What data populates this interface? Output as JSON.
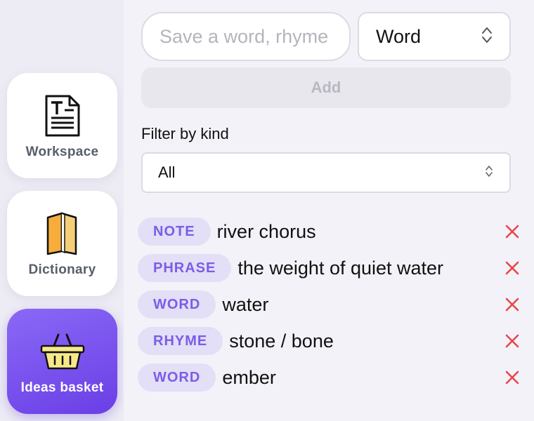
{
  "sidebar": {
    "items": [
      {
        "label": "Workspace",
        "icon": "document-icon",
        "active": false
      },
      {
        "label": "Dictionary",
        "icon": "book-icon",
        "active": false
      },
      {
        "label": "Ideas basket",
        "icon": "basket-icon",
        "active": true
      }
    ]
  },
  "composer": {
    "input_placeholder": "Save a word, rhyme",
    "input_value": "",
    "kind_value": "Word",
    "add_label": "Add"
  },
  "filter": {
    "label": "Filter by kind",
    "value": "All"
  },
  "ideas": [
    {
      "kind": "NOTE",
      "text": "river chorus"
    },
    {
      "kind": "PHRASE",
      "text": "the weight of quiet water"
    },
    {
      "kind": "WORD",
      "text": "water"
    },
    {
      "kind": "RHYME",
      "text": "stone / bone"
    },
    {
      "kind": "WORD",
      "text": "ember"
    }
  ],
  "colors": {
    "accent": "#7c5ce8",
    "active_nav": "#6a3fe6",
    "badge_bg": "#e2dff6",
    "delete": "#e5484d"
  }
}
